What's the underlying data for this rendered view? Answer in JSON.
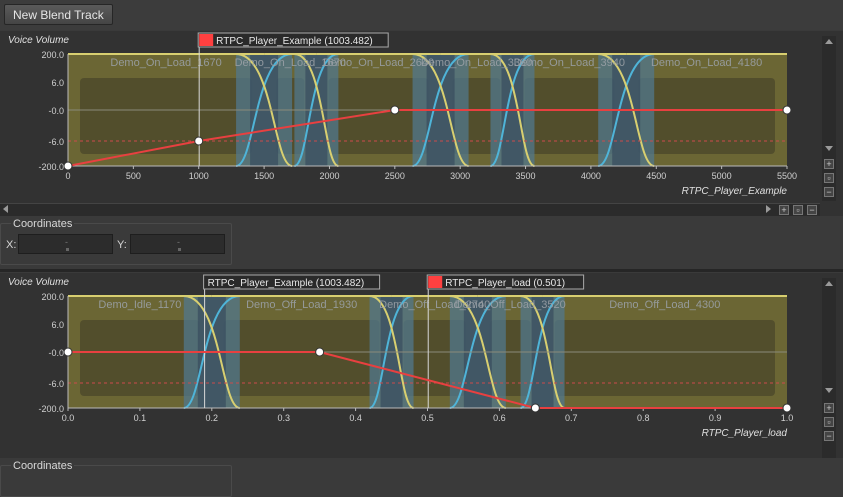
{
  "toolbar": {
    "new_blend_track": "New Blend Track"
  },
  "graphs": [
    {
      "y_title": "Voice Volume",
      "x_title": "RTPC_Player_Example",
      "y_ticks": [
        "200.0",
        "6.0",
        "-0.0",
        "-6.0",
        "-200.0"
      ],
      "x_ticks": [
        "0",
        "500",
        "1000",
        "1500",
        "2000",
        "2500",
        "3000",
        "3500",
        "4000",
        "4500",
        "5000",
        "5500"
      ],
      "x_range": [
        0,
        5500
      ],
      "markers": [
        {
          "label": "RTPC_Player_Example (1003.482)",
          "x": 1003.482,
          "flag": true
        }
      ],
      "sounds": [
        {
          "name": "Demo_On_Load_1670",
          "start": 0,
          "end": 1500
        },
        {
          "name": "Demo_On_Load_1670",
          "start": 1500,
          "end": 1900
        },
        {
          "name": "Demo_On_Load_2640",
          "start": 1900,
          "end": 2850
        },
        {
          "name": "Demo_On_Load_3380",
          "start": 2850,
          "end": 3400
        },
        {
          "name": "Demo_On_Load_3940",
          "start": 3400,
          "end": 4270
        },
        {
          "name": "Demo_On_Load_4180",
          "start": 4270,
          "end": 5500
        }
      ],
      "curve_points": [
        [
          0,
          -200.0
        ],
        [
          1000,
          -6.0
        ],
        [
          2500,
          -0.0
        ],
        [
          5500,
          -0.0
        ]
      ]
    },
    {
      "y_title": "Voice Volume",
      "x_title": "RTPC_Player_load",
      "y_ticks": [
        "200.0",
        "6.0",
        "-0.0",
        "-6.0",
        "-200.0"
      ],
      "x_ticks": [
        "0.0",
        "0.1",
        "0.2",
        "0.3",
        "0.4",
        "0.5",
        "0.6",
        "0.7",
        "0.8",
        "0.9",
        "1.0"
      ],
      "x_range": [
        0,
        1
      ],
      "markers": [
        {
          "label": "RTPC_Player_Example (1003.482)",
          "x": 0.19,
          "flag": false
        },
        {
          "label": "RTPC_Player_load (0.501)",
          "x": 0.501,
          "flag": true
        }
      ],
      "sounds": [
        {
          "name": "Demo_Idle_1170",
          "start": 0,
          "end": 0.2
        },
        {
          "name": "Demo_Off_Load_1930",
          "start": 0.2,
          "end": 0.45
        },
        {
          "name": "Demo_Off_Load_2740",
          "start": 0.45,
          "end": 0.57
        },
        {
          "name": "Demo_Off_Load_3520",
          "start": 0.57,
          "end": 0.66
        },
        {
          "name": "Demo_Off_Load_4300",
          "start": 0.66,
          "end": 1.0
        }
      ],
      "curve_points": [
        [
          0,
          -0.0
        ],
        [
          0.35,
          -0.0
        ],
        [
          0.65,
          -200.0
        ],
        [
          1.0,
          -200.0
        ]
      ]
    }
  ],
  "coordinates": {
    "title": "Coordinates",
    "x_label": "X:",
    "y_label": "Y:",
    "x_value": "-",
    "y_value": "-"
  },
  "colors": {
    "plot_bg": "#6b6634",
    "block": "#4e4a2b",
    "overlap": "#52788c",
    "overlap_deep": "#384c5e",
    "curve": "#e84040",
    "fade_yellow": "#d8cf70",
    "fade_blue": "#4fb4d8",
    "dashed": "#cc4b4b",
    "flag": "#ff4040"
  }
}
